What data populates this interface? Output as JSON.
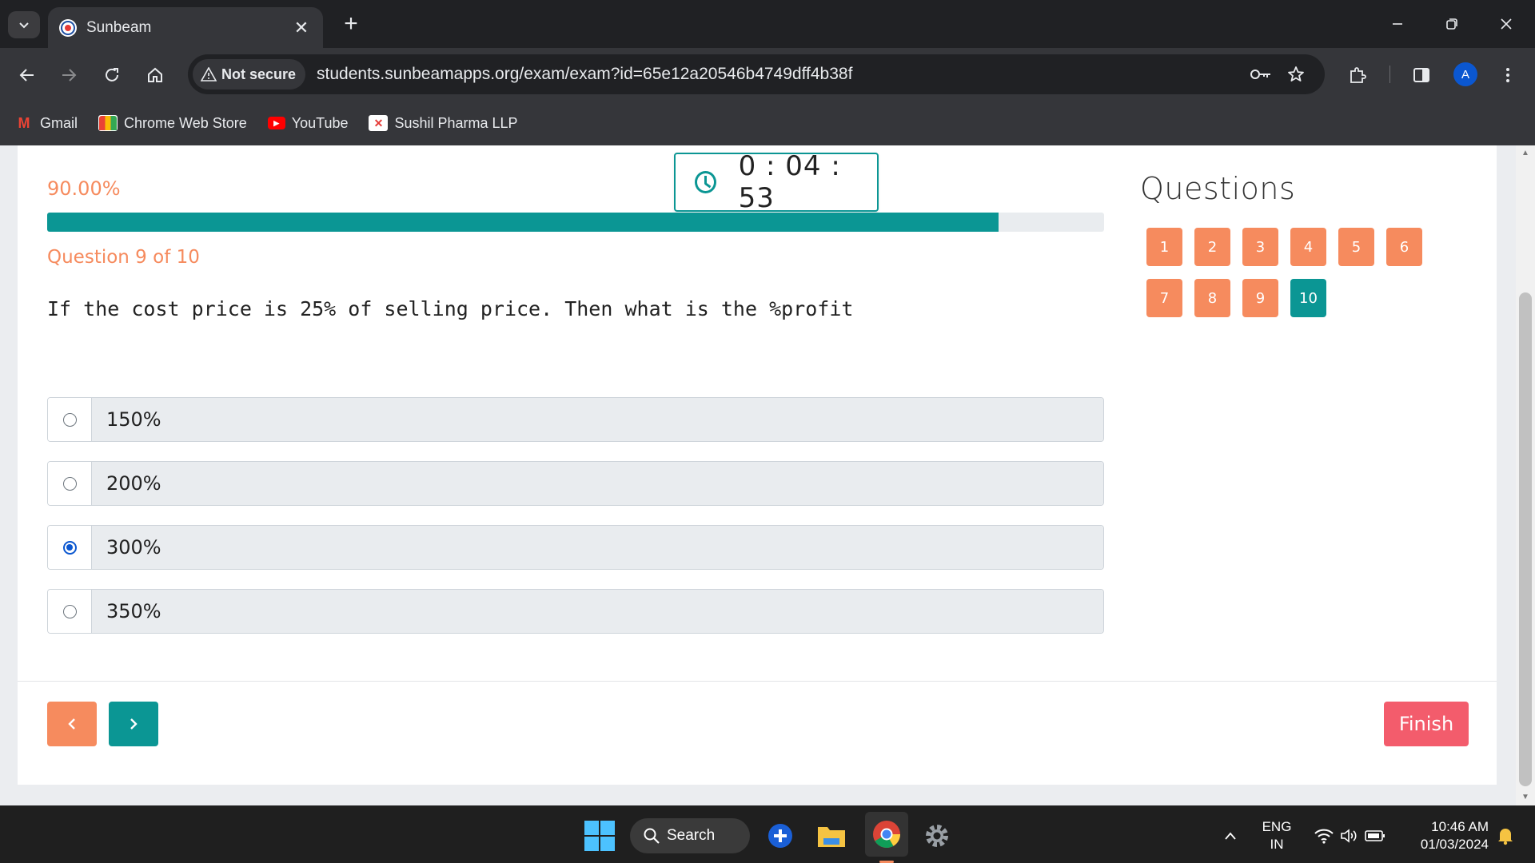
{
  "browser": {
    "tab_title": "Sunbeam",
    "security_label": "Not secure",
    "url": "students.sunbeamapps.org/exam/exam?id=65e12a20546b4749dff4b38f",
    "profile_initial": "A",
    "bookmarks": [
      {
        "label": "Gmail",
        "icon": "gmail-icon"
      },
      {
        "label": "Chrome Web Store",
        "icon": "chrome-web-store-icon"
      },
      {
        "label": "YouTube",
        "icon": "youtube-icon"
      },
      {
        "label": "Sushil Pharma LLP",
        "icon": "sushil-pharma-icon"
      }
    ]
  },
  "exam": {
    "progress_text": "90.00%",
    "progress_value": 0.9,
    "question_counter": "Question 9 of 10",
    "timer": "0 : 04 : 53",
    "question_text": "If the cost price is 25% of selling price. Then what is the %profit",
    "options": [
      {
        "label": "150%",
        "selected": false
      },
      {
        "label": "200%",
        "selected": false
      },
      {
        "label": "300%",
        "selected": true
      },
      {
        "label": "350%",
        "selected": false
      }
    ],
    "prev_label": "‹",
    "next_label": "›",
    "finish_label": "Finish",
    "questions_title": "Questions",
    "question_numbers": [
      "1",
      "2",
      "3",
      "4",
      "5",
      "6",
      "7",
      "8",
      "9",
      "10"
    ],
    "current_question": "10",
    "colors": {
      "accent": "#0b9694",
      "orange": "#f68b5e",
      "finish": "#f35c6c"
    }
  },
  "taskbar": {
    "search_label": "Search",
    "language_line1": "ENG",
    "language_line2": "IN",
    "time": "10:46 AM",
    "date": "01/03/2024"
  }
}
